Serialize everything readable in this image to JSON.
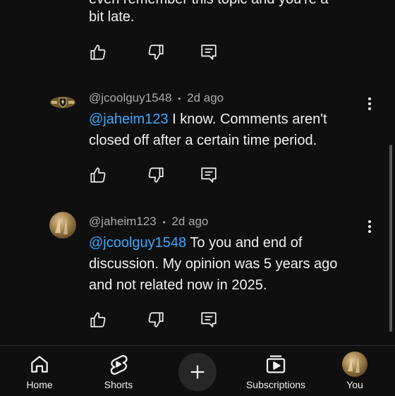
{
  "comments": [
    {
      "text_partial": "bit late.",
      "text_partial_top": "even remember this topic and you're a"
    },
    {
      "author": "@jcoolguy1548",
      "separator": "•",
      "time": "2d ago",
      "mention": "@jaheim123",
      "body_line1": " I know. Comments aren't",
      "body_line2": "closed off after a certain time period."
    },
    {
      "author": "@jaheim123",
      "separator": "•",
      "time": "2d ago",
      "mention": "@jcoolguy1548",
      "body_line1": " To you and end of",
      "body_line2": "discussion. My opinion was 5 years ago",
      "body_line3": "and not related now in 2025."
    }
  ],
  "nav": {
    "home": "Home",
    "shorts": "Shorts",
    "subscriptions": "Subscriptions",
    "you": "You"
  },
  "colors": {
    "background": "#0f0f0f",
    "mention": "#3ea6ff",
    "meta": "#aaaaaa",
    "text": "#f1f1f1"
  }
}
